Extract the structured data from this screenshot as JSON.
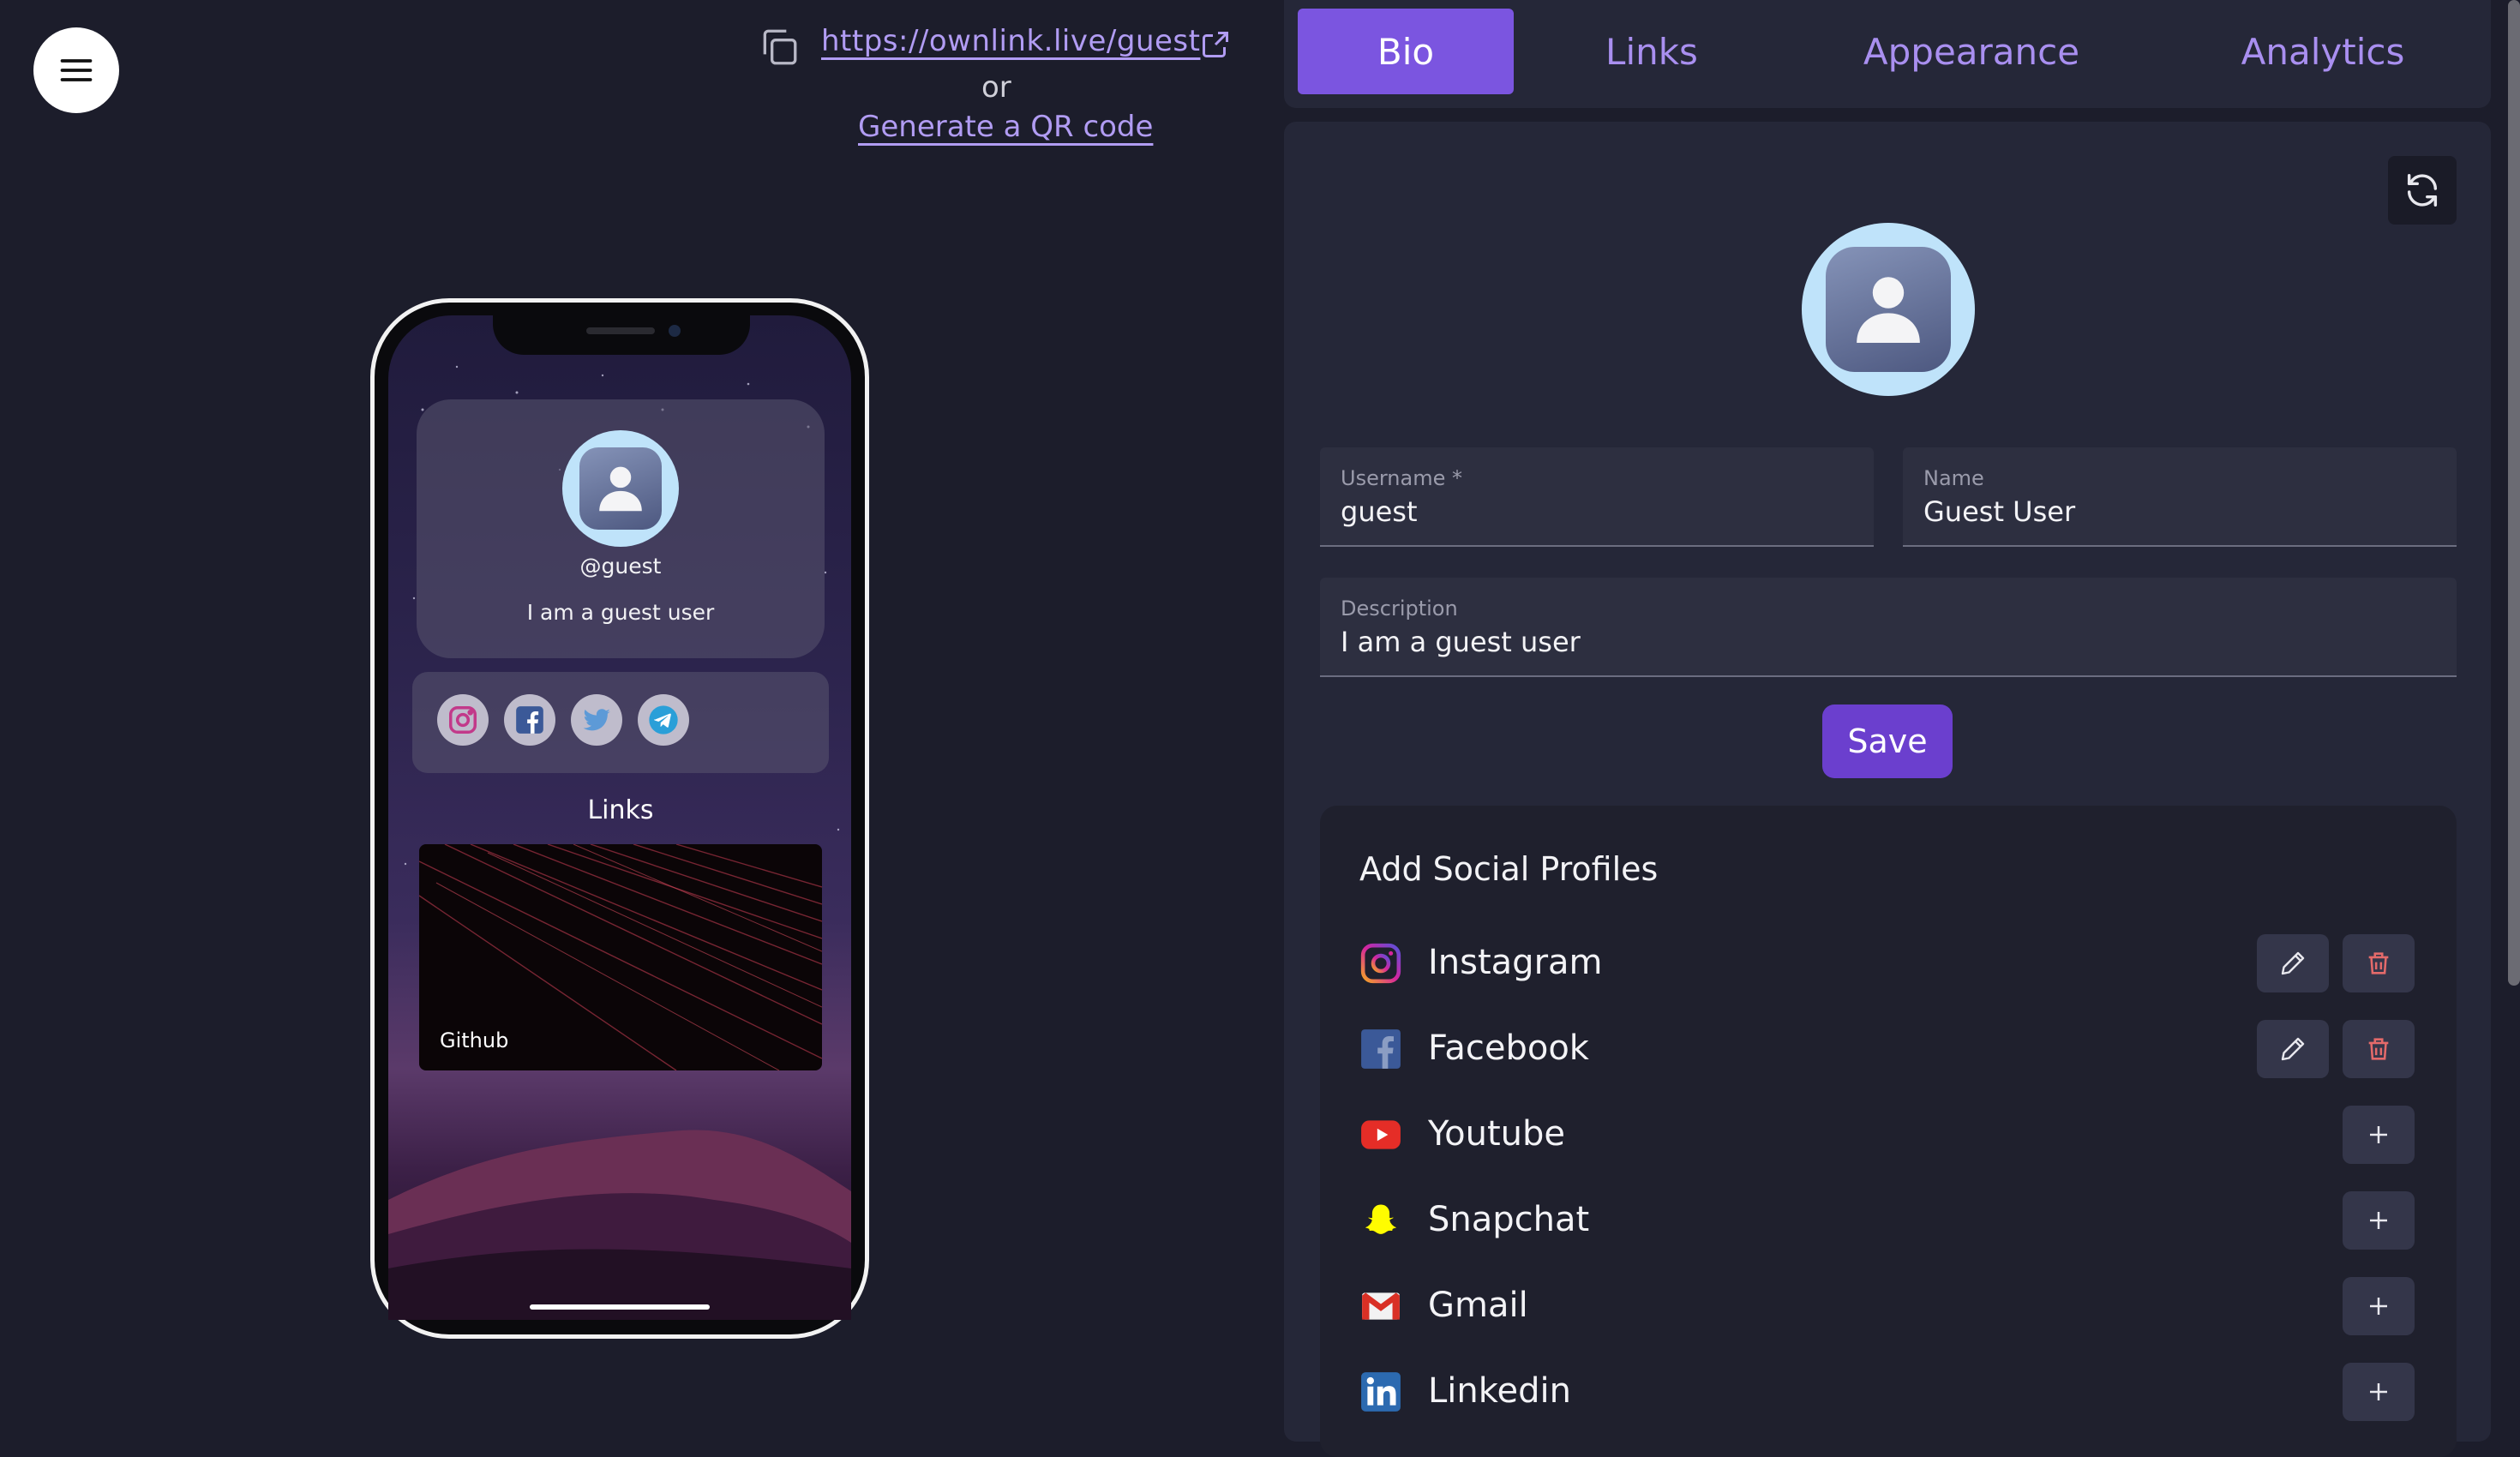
{
  "share": {
    "url": "https://ownlink.live/guest",
    "or_text": "or",
    "qr_label": "Generate a QR code"
  },
  "phone_preview": {
    "handle": "@guest",
    "description": "I am a guest user",
    "social_icons": [
      "instagram-icon",
      "facebook-icon",
      "twitter-icon",
      "telegram-icon"
    ],
    "links_title": "Links",
    "link_cards": [
      {
        "label": "Github"
      }
    ]
  },
  "tabs": [
    {
      "label": "Bio",
      "active": true
    },
    {
      "label": "Links",
      "active": false
    },
    {
      "label": "Appearance",
      "active": false
    },
    {
      "label": "Analytics",
      "active": false
    }
  ],
  "form": {
    "username": {
      "label": "Username *",
      "value": "guest"
    },
    "name": {
      "label": "Name",
      "value": "Guest User"
    },
    "description": {
      "label": "Description",
      "value": "I am a guest user"
    },
    "save_label": "Save"
  },
  "social_profiles": {
    "title": "Add Social Profiles",
    "items": [
      {
        "label": "Instagram",
        "icon": "instagram-icon",
        "added": true
      },
      {
        "label": "Facebook",
        "icon": "facebook-icon",
        "added": true
      },
      {
        "label": "Youtube",
        "icon": "youtube-icon",
        "added": false
      },
      {
        "label": "Snapchat",
        "icon": "snapchat-icon",
        "added": false
      },
      {
        "label": "Gmail",
        "icon": "gmail-icon",
        "added": false
      },
      {
        "label": "Linkedin",
        "icon": "linkedin-icon",
        "added": false
      }
    ]
  },
  "colors": {
    "background": "#1c1d2b",
    "panel": "#252738",
    "accent": "#7b55e0",
    "link": "#b19cf3"
  }
}
